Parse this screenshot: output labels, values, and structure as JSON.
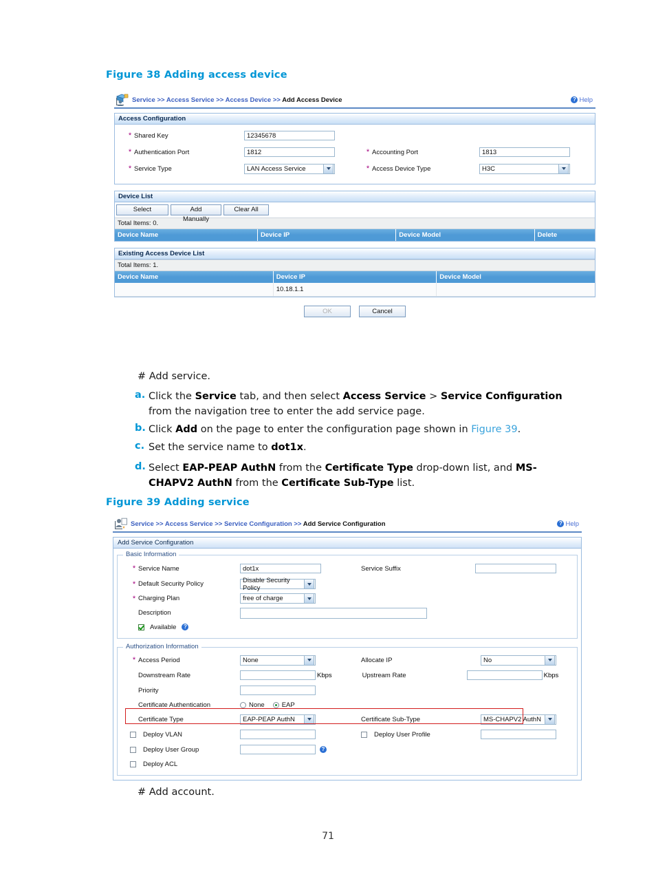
{
  "document": {
    "page_number": "71",
    "figure38_title": "Figure 38 Adding access device",
    "figure39_title": "Figure 39 Adding service",
    "add_service_heading": "# Add service.",
    "add_account_heading": "# Add account.",
    "steps": [
      {
        "marker": "a.",
        "parts": [
          {
            "text": "Click the ",
            "bold": false
          },
          {
            "text": "Service",
            "bold": true
          },
          {
            "text": " tab, and then select ",
            "bold": false
          },
          {
            "text": "Access Service",
            "bold": true
          },
          {
            "text": " > ",
            "bold": false
          },
          {
            "text": "Service Configuration",
            "bold": true
          },
          {
            "text": " from the navigation tree to enter the add service page.",
            "bold": false
          }
        ]
      },
      {
        "marker": "b.",
        "parts": [
          {
            "text": "Click ",
            "bold": false
          },
          {
            "text": "Add",
            "bold": true
          },
          {
            "text": " on the page to enter the configuration page shown in ",
            "bold": false
          },
          {
            "text": "Figure 39",
            "bold": false,
            "link": true
          },
          {
            "text": ".",
            "bold": false
          }
        ]
      },
      {
        "marker": "c.",
        "parts": [
          {
            "text": "Set the service name to ",
            "bold": false
          },
          {
            "text": "dot1x",
            "bold": true
          },
          {
            "text": ".",
            "bold": false
          }
        ]
      },
      {
        "marker": "d.",
        "parts": [
          {
            "text": "Select ",
            "bold": false
          },
          {
            "text": "EAP-PEAP AuthN",
            "bold": true
          },
          {
            "text": " from the ",
            "bold": false
          },
          {
            "text": "Certificate Type",
            "bold": true
          },
          {
            "text": " drop-down list, and ",
            "bold": false
          },
          {
            "text": "MS-CHAPV2 AuthN",
            "bold": true
          },
          {
            "text": " from the ",
            "bold": false
          },
          {
            "text": "Certificate Sub-Type",
            "bold": true
          },
          {
            "text": " list.",
            "bold": false
          }
        ]
      }
    ]
  },
  "figure38": {
    "breadcrumb": {
      "icon": "access-device-icon",
      "items": [
        "Service",
        "Access Service",
        "Access Device"
      ],
      "separator": ">>",
      "current": "Add Access Device"
    },
    "help_label": "Help",
    "access_configuration": {
      "panel_title": "Access Configuration",
      "fields": {
        "shared_key": {
          "label": "Shared Key",
          "value": "12345678",
          "required": true
        },
        "authentication_port": {
          "label": "Authentication Port",
          "value": "1812",
          "required": true
        },
        "accounting_port": {
          "label": "Accounting Port",
          "value": "1813",
          "required": true
        },
        "service_type": {
          "label": "Service Type",
          "value": "LAN Access Service",
          "required": true
        },
        "access_device_type": {
          "label": "Access Device Type",
          "value": "H3C",
          "required": true
        }
      }
    },
    "device_list": {
      "panel_title": "Device List",
      "buttons": [
        "Select",
        "Add Manually",
        "Clear All"
      ],
      "total_items": "Total Items: 0.",
      "columns": [
        "Device Name",
        "Device IP",
        "Device Model",
        "Delete"
      ],
      "rows": []
    },
    "existing_device_list": {
      "panel_title": "Existing Access Device List",
      "total_items": "Total Items: 1.",
      "columns": [
        "Device Name",
        "Device IP",
        "Device Model"
      ],
      "rows": [
        [
          "",
          "10.18.1.1",
          ""
        ]
      ]
    },
    "actions": {
      "ok": "OK",
      "cancel": "Cancel",
      "ok_disabled": true
    }
  },
  "figure39": {
    "breadcrumb": {
      "icon": "service-configuration-icon",
      "items": [
        "Service",
        "Access Service",
        "Service Configuration"
      ],
      "separator": ">>",
      "current": "Add Service Configuration"
    },
    "help_label": "Help",
    "panel_title": "Add Service Configuration",
    "basic_information": {
      "legend": "Basic Information",
      "service_name": {
        "label": "Service Name",
        "value": "dot1x",
        "required": true
      },
      "service_suffix": {
        "label": "Service Suffix",
        "value": "",
        "required": false
      },
      "default_security_policy": {
        "label": "Default Security Policy",
        "value": "Disable Security Policy",
        "required": true
      },
      "charging_plan": {
        "label": "Charging Plan",
        "value": "free of charge",
        "required": true
      },
      "description": {
        "label": "Description",
        "value": "",
        "required": false
      },
      "available": {
        "label": "Available",
        "checked": true
      }
    },
    "authorization_information": {
      "legend": "Authorization Information",
      "access_period": {
        "label": "Access Period",
        "value": "None",
        "required": true
      },
      "allocate_ip": {
        "label": "Allocate IP",
        "value": "No",
        "required": false
      },
      "downstream_rate": {
        "label": "Downstream Rate",
        "value": "",
        "unit": "Kbps"
      },
      "upstream_rate": {
        "label": "Upstream Rate",
        "value": "",
        "unit": "Kbps"
      },
      "priority": {
        "label": "Priority",
        "value": ""
      },
      "certificate_authentication": {
        "label": "Certificate Authentication",
        "options": [
          "None",
          "EAP"
        ],
        "selected": "EAP"
      },
      "certificate_type": {
        "label": "Certificate Type",
        "value": "EAP-PEAP AuthN"
      },
      "certificate_sub_type": {
        "label": "Certificate Sub-Type",
        "value": "MS-CHAPV2 AuthN"
      },
      "deploy_vlan": {
        "label": "Deploy VLAN",
        "checked": false,
        "value": ""
      },
      "deploy_user_profile": {
        "label": "Deploy User Profile",
        "checked": false,
        "value": ""
      },
      "deploy_user_group": {
        "label": "Deploy User Group",
        "checked": false,
        "value": ""
      },
      "deploy_acl": {
        "label": "Deploy ACL",
        "checked": false
      }
    },
    "highlight_color": "#d21b1b"
  }
}
